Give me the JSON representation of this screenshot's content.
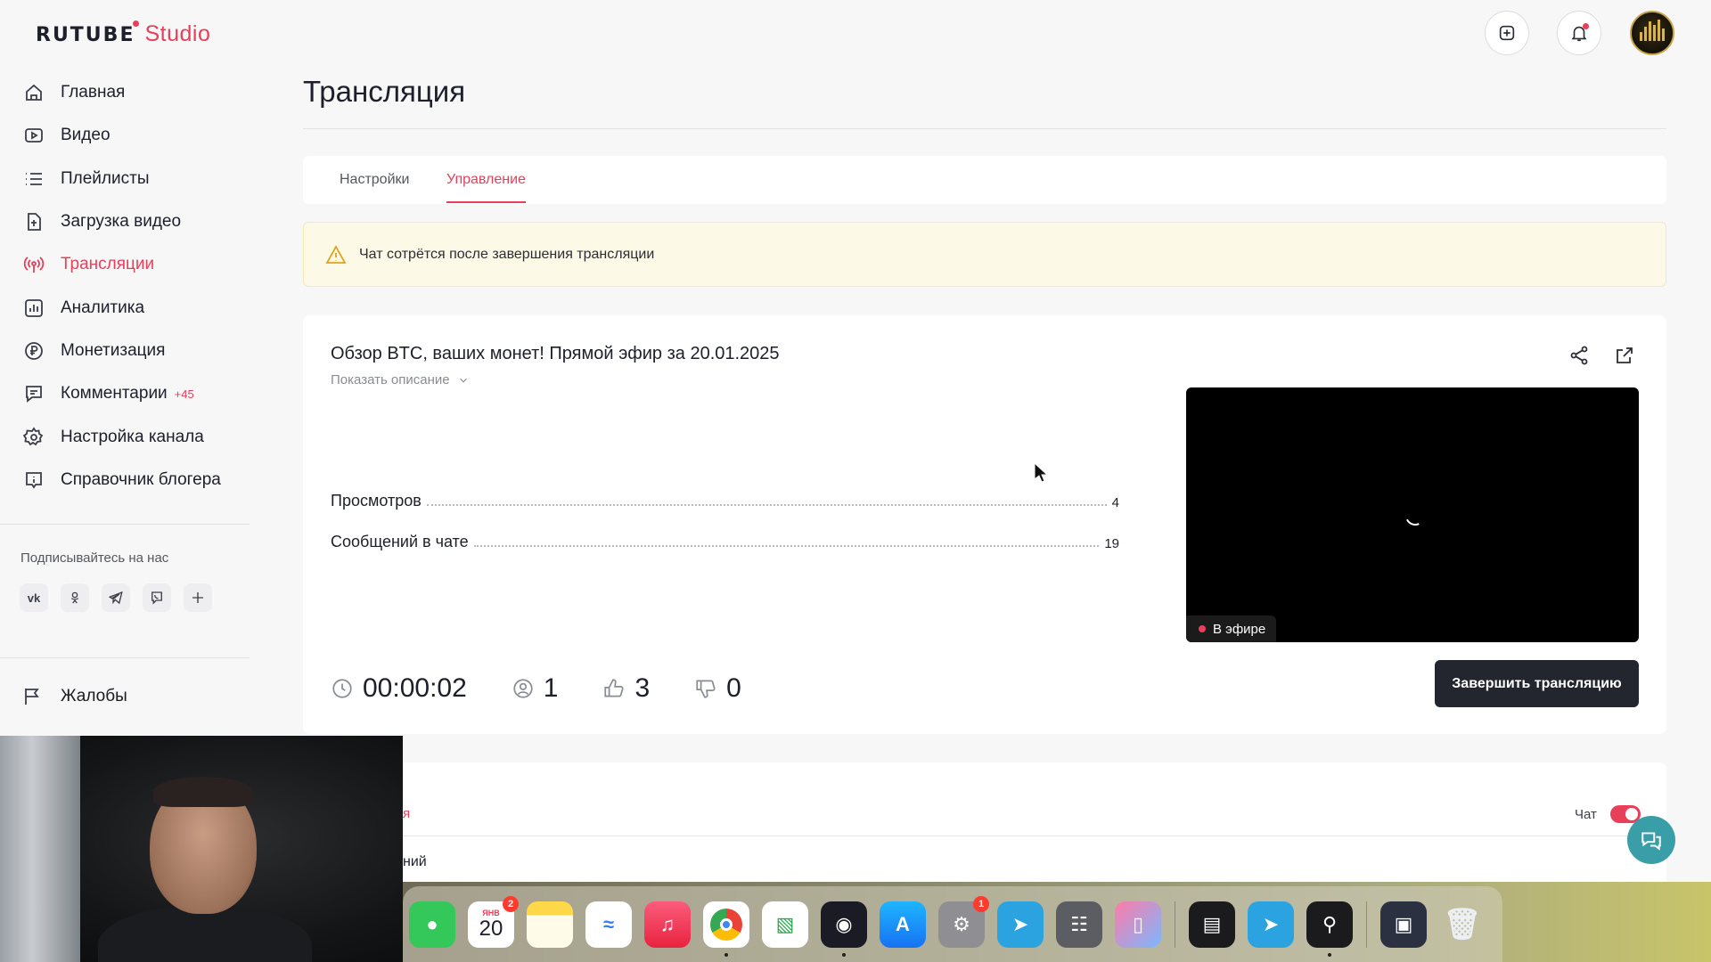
{
  "logo": {
    "primary": "RUTUBE",
    "secondary": "Studio"
  },
  "sidebar": {
    "items": [
      {
        "label": "Главная",
        "icon": "home-icon"
      },
      {
        "label": "Видео",
        "icon": "video-icon"
      },
      {
        "label": "Плейлисты",
        "icon": "playlist-icon"
      },
      {
        "label": "Загрузка видео",
        "icon": "upload-icon"
      },
      {
        "label": "Трансляции",
        "icon": "broadcast-icon",
        "active": true
      },
      {
        "label": "Аналитика",
        "icon": "analytics-icon"
      },
      {
        "label": "Монетизация",
        "icon": "ruble-icon"
      },
      {
        "label": "Комментарии",
        "icon": "comment-icon",
        "badge": "+45"
      },
      {
        "label": "Настройка канала",
        "icon": "gear-icon"
      },
      {
        "label": "Справочник блогера",
        "icon": "info-icon"
      }
    ],
    "follow_label": "Подписывайтесь на нас",
    "socials": [
      "vk",
      "ok",
      "telegram",
      "viber",
      "more"
    ],
    "complaints_label": "Жалобы"
  },
  "page": {
    "title": "Трансляция",
    "tabs": [
      {
        "label": "Настройки"
      },
      {
        "label": "Управление",
        "active": true
      }
    ],
    "alert": "Чат сотрётся после завершения трансляции"
  },
  "stream": {
    "title": "Обзор BTC, ваших монет! Прямой эфир за 20.01.2025",
    "show_description": "Показать описание",
    "stats": [
      {
        "label": "Просмотров",
        "value": "4"
      },
      {
        "label": "Сообщений в чате",
        "value": "19"
      }
    ],
    "live_label": "В эфире",
    "duration": "00:00:02",
    "viewers": "1",
    "likes": "3",
    "dislikes": "0",
    "end_button": "Завершить трансляцию"
  },
  "chat_panel": {
    "tab_fragment": "я",
    "sub_fragment": "ний",
    "chat_label": "Чат",
    "chat_enabled": true
  },
  "dock": {
    "calendar_month": "ЯНВ",
    "calendar_day": "20",
    "calendar_badge": "2",
    "settings_badge": "1"
  },
  "colors": {
    "accent": "#e8405a",
    "dark_button": "#24262f",
    "alert_bg": "#fdf9e7",
    "help_fab": "#3a9ea8"
  }
}
